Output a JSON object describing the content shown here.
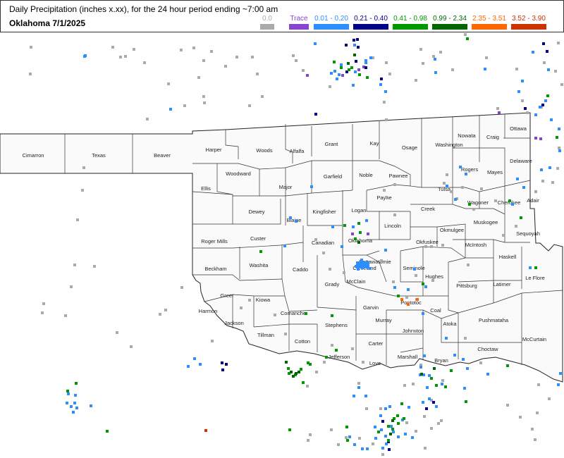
{
  "header": {
    "title": "Daily Precipitation (inches  x.xx),  for the 24 hour period ending ~7:00 am",
    "subtitle": "Oklahoma 7/1/2025"
  },
  "legend": [
    {
      "label": "0.0",
      "color": "#aaaaaa"
    },
    {
      "label": "Trace",
      "color": "#8844cc"
    },
    {
      "label": "0.01 - 0.20",
      "color": "#2d8fff"
    },
    {
      "label": "0.21 - 0.40",
      "color": "#000088"
    },
    {
      "label": "0.41 - 0.98",
      "color": "#009900"
    },
    {
      "label": "0.99 - 2.34",
      "color": "#006600"
    },
    {
      "label": "2.35 - 3.51",
      "color": "#ff6600"
    },
    {
      "label": "3.52 - 3.90",
      "color": "#cc3300"
    }
  ],
  "counties": [
    "Cimarron",
    "Texas",
    "Beaver",
    "Harper",
    "Woods",
    "Alfalfa",
    "Grant",
    "Kay",
    "Osage",
    "Washington",
    "Nowata",
    "Craig",
    "Ottawa",
    "Delaware",
    "Mayes",
    "Rogers",
    "Pawnee",
    "Noble",
    "Garfield",
    "Major",
    "Woodward",
    "Ellis",
    "Dewey",
    "Blaine",
    "Kingfisher",
    "Logan",
    "Payne",
    "Creek",
    "Tulsa",
    "Wagoner",
    "Cherokee",
    "Adair",
    "Sequoyah",
    "Muskogee",
    "Okmulgee",
    "Okfuskee",
    "McIntosh",
    "Haskell",
    "Le Flore",
    "Latimer",
    "Pittsburg",
    "Hughes",
    "Seminole",
    "Pottawatomie",
    "Lincoln",
    "Oklahoma",
    "Canadian",
    "Custer",
    "Roger Mills",
    "Beckham",
    "Washita",
    "Caddo",
    "Grady",
    "McClain",
    "Cleveland",
    "Garvin",
    "Pontotoc",
    "Coal",
    "Atoka",
    "Pushmataha",
    "McCurtain",
    "Choctaw",
    "Bryan",
    "Johnston",
    "Murray",
    "Carter",
    "Love",
    "Marshall",
    "Jefferson",
    "Stephens",
    "Cotton",
    "Comanche",
    "Tillman",
    "Jackson",
    "Greer",
    "Harmon",
    "Kiowa"
  ]
}
